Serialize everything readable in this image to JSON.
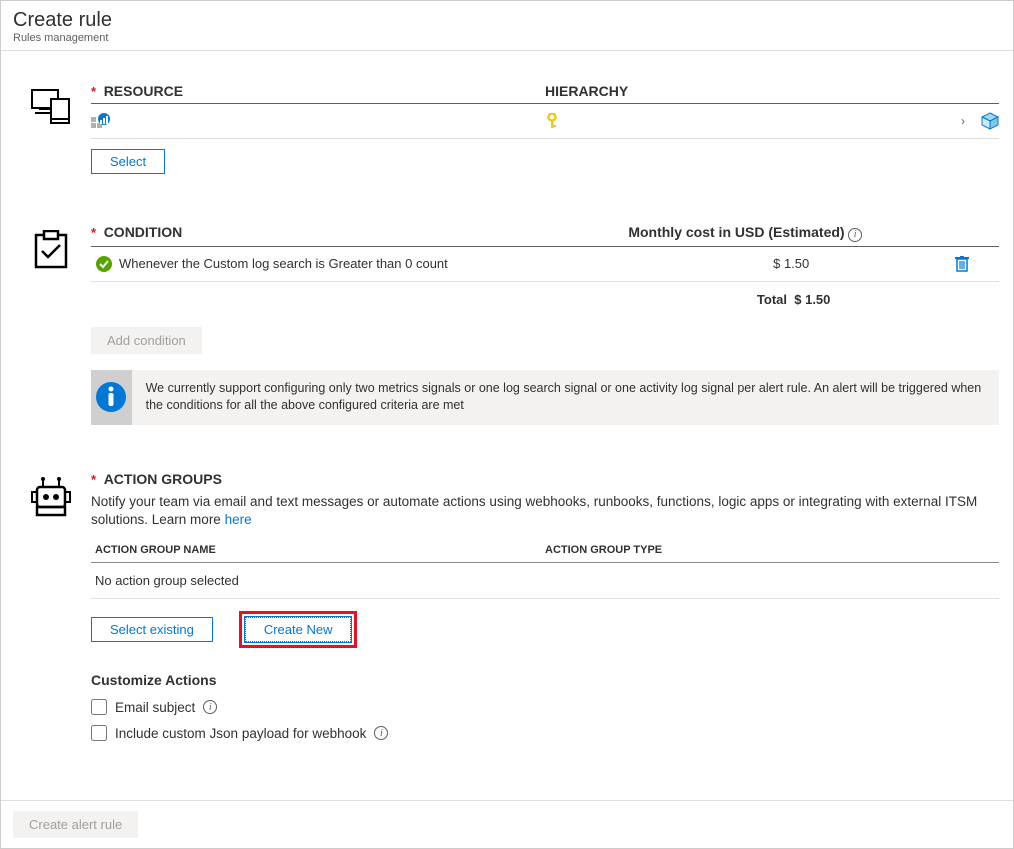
{
  "header": {
    "title": "Create rule",
    "subtitle": "Rules management"
  },
  "resource": {
    "label": "RESOURCE",
    "hierarchy_label": "HIERARCHY",
    "select_button": "Select"
  },
  "condition": {
    "label": "CONDITION",
    "cost_label": "Monthly cost in USD (Estimated)",
    "rows": [
      {
        "text": "Whenever the Custom log search is Greater than 0 count",
        "cost": "$ 1.50"
      }
    ],
    "total_label": "Total",
    "total_value": "$ 1.50",
    "add_button": "Add condition",
    "banner": "We currently support configuring only two metrics signals or one log search signal or one activity log signal per alert rule. An alert will be triggered when the conditions for all the above configured criteria are met"
  },
  "action_groups": {
    "label": "ACTION GROUPS",
    "description": "Notify your team via email and text messages or automate actions using webhooks, runbooks, functions, logic apps or integrating with external ITSM solutions. Learn more ",
    "learn_more": "here",
    "col_name": "ACTION GROUP NAME",
    "col_type": "ACTION GROUP TYPE",
    "empty": "No action group selected",
    "select_existing": "Select existing",
    "create_new": "Create New",
    "customize_title": "Customize Actions",
    "email_subject_label": "Email subject",
    "json_payload_label": "Include custom Json payload for webhook"
  },
  "footer": {
    "create_button": "Create alert rule"
  }
}
